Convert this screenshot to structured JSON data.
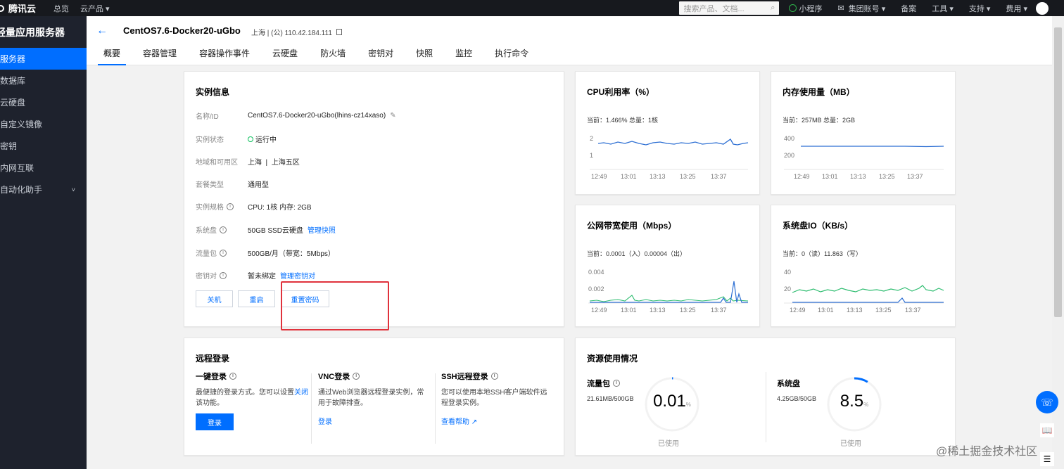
{
  "topbar": {
    "logo": "腾讯云",
    "nav": [
      "总览",
      "云产品 ▾"
    ],
    "search_placeholder": "搜索产品、文档...",
    "items": [
      "小程序",
      "集团账号 ▾",
      "备案",
      "工具 ▾",
      "支持 ▾",
      "费用 ▾"
    ]
  },
  "sidebar": {
    "title": "轻量应用服务器",
    "items": [
      {
        "label": "服务器",
        "active": true
      },
      {
        "label": "数据库"
      },
      {
        "label": "云硬盘"
      },
      {
        "label": "自定义镜像"
      },
      {
        "label": "密钥"
      },
      {
        "label": "内网互联"
      },
      {
        "label": "自动化助手",
        "chevron": "˅"
      }
    ]
  },
  "header": {
    "title": "CentOS7.6-Docker20-uGbo",
    "location_ip": "上海 | (公) 110.42.184.111",
    "tabs": [
      "概要",
      "容器管理",
      "容器操作事件",
      "云硬盘",
      "防火墙",
      "密钥对",
      "快照",
      "监控",
      "执行命令"
    ]
  },
  "instance": {
    "title": "实例信息",
    "rows": [
      {
        "label": "名称/ID",
        "value": "CentOS7.6-Docker20-uGbo(lhins-cz14xaso)"
      },
      {
        "label": "实例状态",
        "value": "运行中"
      },
      {
        "label": "地域和可用区",
        "value": "上海  |  上海五区"
      },
      {
        "label": "套餐类型",
        "value": "通用型"
      },
      {
        "label": "实例规格",
        "value": "CPU: 1核 内存: 2GB"
      },
      {
        "label": "系统盘",
        "value": "50GB SSD云硬盘",
        "link": "管理快照"
      },
      {
        "label": "流量包",
        "value": "500GB/月（带宽：5Mbps）"
      },
      {
        "label": "密钥对",
        "value": "暂未绑定",
        "link": "管理密钥对"
      }
    ],
    "buttons": [
      "关机",
      "重启",
      "重置密码"
    ]
  },
  "metrics": {
    "cpu": {
      "title": "CPU利用率（%）",
      "current": "当前：1.466% 总量：1核",
      "yticks": [
        "2",
        "1"
      ],
      "xticks": [
        "12:49",
        "13:01",
        "13:13",
        "13:25",
        "13:37"
      ]
    },
    "mem": {
      "title": "内存使用量（MB）",
      "current": "当前：257MB 总量：2GB",
      "yticks": [
        "400",
        "200"
      ],
      "xticks": [
        "12:49",
        "13:01",
        "13:13",
        "13:25",
        "13:37"
      ]
    },
    "net": {
      "title": "公网带宽使用（Mbps）",
      "current": "当前：0.0001（入）0.00004（出）",
      "yticks": [
        "0.004",
        "0.002"
      ],
      "xticks": [
        "12:49",
        "13:01",
        "13:13",
        "13:25",
        "13:37"
      ]
    },
    "disk": {
      "title": "系统盘IO（KB/s）",
      "current": "当前：0（读）11.863（写）",
      "yticks": [
        "40",
        "20"
      ],
      "xticks": [
        "12:49",
        "13:01",
        "13:13",
        "13:25",
        "13:37"
      ]
    }
  },
  "remote": {
    "title": "远程登录",
    "one_click": {
      "title": "一键登录",
      "desc1": "最便捷的登录方式。您可以设置",
      "link": "关闭",
      "desc2": "该功能。",
      "button": "登录"
    },
    "vnc": {
      "title": "VNC登录",
      "desc": "通过Web浏览器远程登录实例，常用于故障排查。",
      "link": "登录"
    },
    "ssh": {
      "title": "SSH远程登录",
      "desc": "您可以使用本地SSH客户端软件远程登录实例。",
      "link": "查看帮助"
    }
  },
  "resources": {
    "title": "资源使用情况",
    "traffic": {
      "label": "流量包",
      "value": "21.61MB/500GB",
      "percent": "0.01",
      "used": "已使用",
      "fraction": 0.0001
    },
    "disk": {
      "label": "系统盘",
      "value": "4.25GB/50GB",
      "percent": "8.5",
      "used": "已使用",
      "fraction": 0.085
    }
  },
  "percent_sign": "%",
  "watermark": "@稀土掘金技术社区",
  "colors": {
    "accent": "#006eff",
    "highlight": "#e0323c",
    "cpu_line": "#2d6fd3",
    "green_line": "#2ebd70"
  }
}
